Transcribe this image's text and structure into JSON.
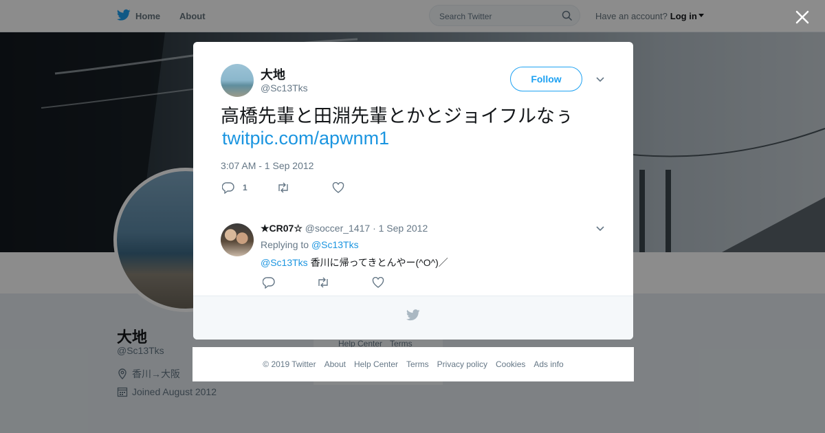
{
  "nav": {
    "home_label": "Home",
    "about_label": "About",
    "search_placeholder": "Search Twitter",
    "account_prompt": "Have an account?",
    "login_label": "Log in"
  },
  "profile": {
    "name": "大地",
    "handle": "@Sc13Tks",
    "location": "香川→大阪",
    "joined": "Joined August 2012"
  },
  "side_footer": {
    "help": "Help Center",
    "terms": "Terms"
  },
  "tweet": {
    "author_name": "大地",
    "author_handle": "@Sc13Tks",
    "follow_label": "Follow",
    "text": "高橋先輩と田淵先輩とかとジョイフルなぅ",
    "link": "twitpic.com/apwnm1",
    "timestamp": "3:07 AM - 1 Sep 2012",
    "reply_count": "1"
  },
  "reply": {
    "author_name": "★CR07☆",
    "author_handle": "@soccer_1417",
    "date": "· 1 Sep 2012",
    "replying_prefix": "Replying to",
    "replying_to": "@Sc13Tks",
    "mention": "@Sc13Tks",
    "text": "香川に帰ってきとんやー(^O^)／"
  },
  "footer": [
    "© 2019 Twitter",
    "About",
    "Help Center",
    "Terms",
    "Privacy policy",
    "Cookies",
    "Ads info"
  ],
  "colors": {
    "brand": "#1da1f2",
    "link": "#1b95e0",
    "text": "#14171a",
    "muted": "#657786"
  }
}
